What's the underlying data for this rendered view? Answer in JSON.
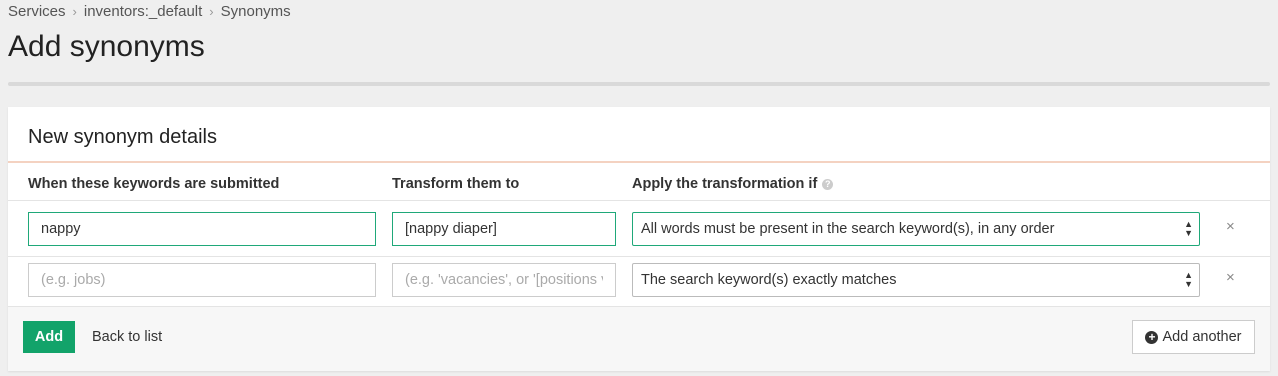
{
  "breadcrumb": {
    "items": [
      "Services",
      "inventors:_default",
      "Synonyms"
    ],
    "separator": "›"
  },
  "page": {
    "title": "Add synonyms"
  },
  "panel": {
    "title": "New synonym details",
    "columns": {
      "keywords": "When these keywords are submitted",
      "transform": "Transform them to",
      "apply": "Apply the transformation if"
    },
    "rows": [
      {
        "keywords_value": "nappy",
        "keywords_placeholder": "",
        "transform_value": "[nappy diaper]",
        "transform_placeholder": "",
        "apply_selected": "All words must be present in the search keyword(s), in any order"
      },
      {
        "keywords_value": "",
        "keywords_placeholder": "(e.g. jobs)",
        "transform_value": "",
        "transform_placeholder": "(e.g. 'vacancies', or '[positions vacancies]')",
        "apply_selected": "The search keyword(s) exactly matches"
      }
    ],
    "remove_glyph": "×",
    "help_glyph": "?"
  },
  "footer": {
    "add_label": "Add",
    "back_label": "Back to list",
    "add_another_label": "Add another",
    "plus_glyph": "+"
  },
  "colors": {
    "accent": "#12a36a",
    "input_focus": "#1fa879",
    "divider": "#f4d2c1"
  }
}
